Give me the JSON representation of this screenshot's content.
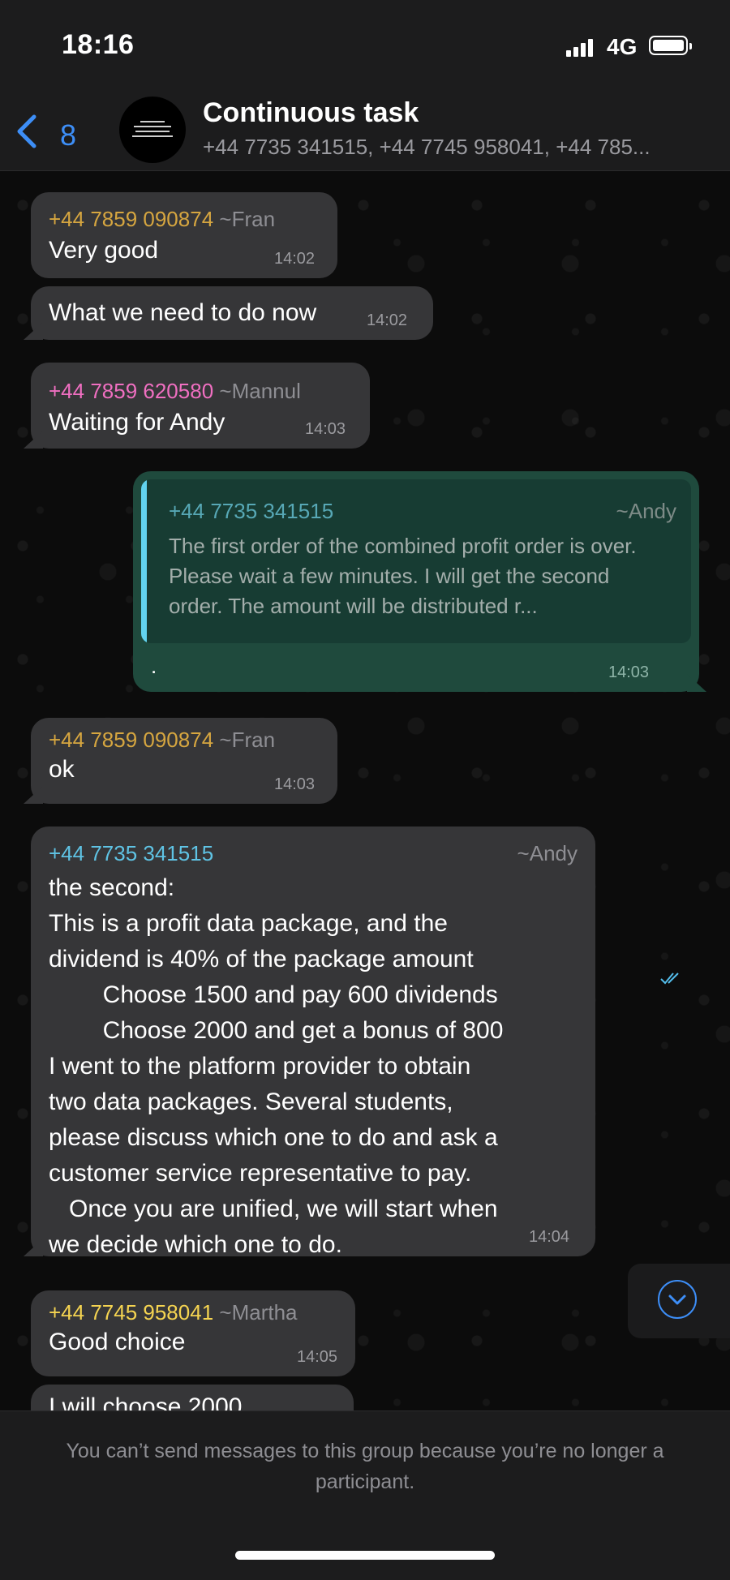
{
  "status_bar": {
    "time": "18:16",
    "network": "4G"
  },
  "header": {
    "back_count": "8",
    "title": "Continuous task",
    "participants": "+44 7735 341515, +44 7745 958041, +44 785..."
  },
  "messages": [
    {
      "sender": "+44 7859 090874",
      "pushname": "~Fran",
      "text": "Very good",
      "time": "14:02"
    },
    {
      "text": "What we need to do now",
      "time": "14:02"
    },
    {
      "sender": "+44 7859 620580",
      "pushname": "~Mannul",
      "text": "Waiting for Andy",
      "time": "14:03"
    },
    {
      "outgoing": true,
      "quote": {
        "sender": "+44 7735 341515",
        "pushname": "~Andy",
        "text": "The first order of the combined profit order is over. Please wait a few minutes. I will get the second order. The amount will be distributed r..."
      },
      "text": ".",
      "time": "14:03",
      "read_status": "read"
    },
    {
      "sender": "+44 7859 090874",
      "pushname": "~Fran",
      "text": "ok",
      "time": "14:03"
    },
    {
      "sender": "+44 7735 341515",
      "pushname": "~Andy",
      "lines": [
        "the second:",
        "This is a profit data package, and the",
        "dividend is 40% of the package amount",
        "        Choose 1500 and pay 600 dividends",
        "        Choose 2000 and get a bonus of 800",
        "I went to the platform provider to obtain",
        "two data packages. Several students,",
        "please discuss which one to do and ask a",
        "customer service representative to pay.",
        "   Once you are unified, we will start when",
        "we decide which one to do."
      ],
      "time": "14:04"
    },
    {
      "sender": "+44 7745 958041",
      "pushname": "~Martha",
      "text": "Good choice",
      "time": "14:05"
    },
    {
      "text": "I will choose 2000"
    }
  ],
  "footer": {
    "notice": "You can’t send messages to this group because you’re no longer a participant."
  },
  "colors": {
    "accent": "#3d8ef7",
    "incoming_bubble": "#363638",
    "outgoing_bubble": "#1f4a3d"
  }
}
